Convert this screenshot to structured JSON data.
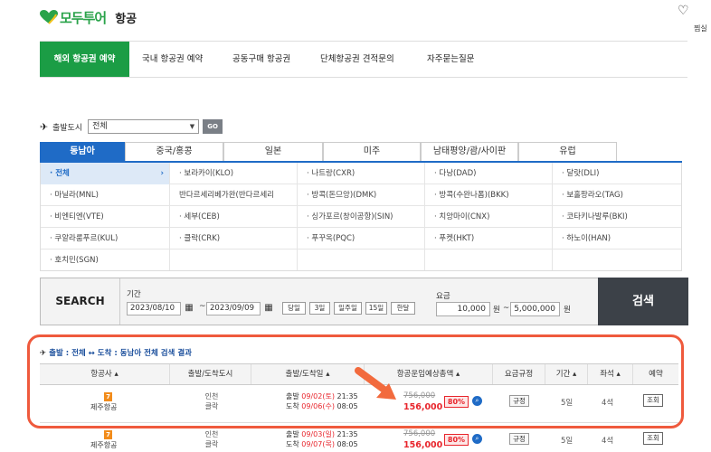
{
  "header": {
    "brand": "모두투어",
    "section": "항공",
    "top_label": "찜실"
  },
  "nav": [
    {
      "label": "해외 항공권 예약",
      "active": true
    },
    {
      "label": "국내 항공권 예약"
    },
    {
      "label": "공동구매 항공권"
    },
    {
      "label": "단체항공권 견적문의"
    },
    {
      "label": "자주묻는질문"
    }
  ],
  "departure": {
    "label": "출발도시",
    "value": "전체",
    "go": "GO"
  },
  "region_tabs": [
    "동남아",
    "중국/홍콩",
    "일본",
    "미주",
    "남태평양/괌/사이판",
    "유럽"
  ],
  "cities": [
    [
      "· 전체",
      "· 보라카이(KLO)",
      "· 나트랑(CXR)",
      "· 다낭(DAD)",
      "· 달랏(DLI)"
    ],
    [
      "· 마닐라(MNL)",
      "반다르세리베가완(반다르세리",
      "· 방콕(돈므앙)(DMK)",
      "· 방콕(수완나폼)(BKK)",
      "· 보홀팡라오(TAG)"
    ],
    [
      "· 비엔티엔(VTE)",
      "· 세부(CEB)",
      "· 싱가포르(창이공항)(SIN)",
      "· 치앙마이(CNX)",
      "· 코타키나발루(BKI)"
    ],
    [
      "· 쿠알라룸푸르(KUL)",
      "· 클락(CRK)",
      "· 푸꾸옥(PQC)",
      "· 푸켓(HKT)",
      "· 하노이(HAN)"
    ],
    [
      "· 호치민(SGN)",
      "",
      "",
      "",
      ""
    ]
  ],
  "search": {
    "label": "SEARCH",
    "period_label": "기간",
    "date_from": "2023/08/10",
    "tilde": "~",
    "date_to": "2023/09/09",
    "period_buttons": [
      "당일",
      "3일",
      "일주일",
      "15일",
      "한달"
    ],
    "fare_label": "요금",
    "fare_min": "10,000",
    "fare_unit": "원",
    "fare_dash": "~",
    "fare_max": "5,000,000",
    "button": "검색"
  },
  "results": {
    "title": "출발 : 전체 ↔ 도착 : 동남아 전체 검색 결과",
    "columns": [
      "항공사 ▴",
      "출발/도착도시",
      "출발/도착일 ▴",
      "항공운임예상총액 ▴",
      "요금규정",
      "기간 ▴",
      "좌석 ▴",
      "예약"
    ],
    "rows": [
      {
        "airline_logo": "7",
        "airline": "제주항공",
        "from_city": "인천",
        "to_city": "클락",
        "dep_prefix": "출발",
        "dep_date": "09/02(토)",
        "dep_time": "21:35",
        "arr_prefix": "도착",
        "arr_date": "09/06(수)",
        "arr_time": "08:05",
        "original_price": "756,000",
        "price": "156,000",
        "discount": "80%",
        "rule": "규정",
        "duration": "5일",
        "seats": "4석",
        "reserve": "조회"
      },
      {
        "airline_logo": "7",
        "airline": "제주항공",
        "from_city": "인천",
        "to_city": "클락",
        "dep_prefix": "출발",
        "dep_date": "09/03(일)",
        "dep_time": "21:35",
        "arr_prefix": "도착",
        "arr_date": "09/07(목)",
        "arr_time": "08:05",
        "original_price": "756,000",
        "price": "156,000",
        "discount": "80%",
        "rule": "규정",
        "duration": "5일",
        "seats": "4석",
        "reserve": "조회"
      }
    ]
  },
  "colors": {
    "brand_green": "#1b9d45",
    "tab_blue": "#1f6bc6",
    "price_red": "#e8252c",
    "highlight": "#ef5a3d"
  }
}
